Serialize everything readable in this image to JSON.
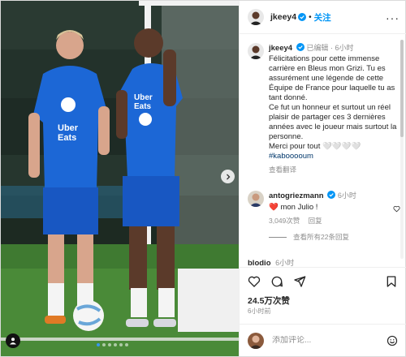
{
  "post": {
    "author": "jkeey4",
    "follow_label": "关注",
    "more_label": "···",
    "verified_icon": "verified-badge-icon",
    "accent": "#0095f6"
  },
  "caption": {
    "author": "jkeey4",
    "edited_label": "已编辑",
    "time": "6小时",
    "text": "Félicitations pour cette immense carrière en Bleus mon Grizi. Tu es assurément une légende de cette Équipe de France pour laquelle tu as tant donné.\nCe fut un honneur et surtout un réel plaisir de partager ces 3 dernières années avec le joueur mais surtout la personne.\nMerci pour tout 🤍🤍🤍🤍",
    "hashtag": "#kabooooum",
    "translate_label": "查看翻译"
  },
  "comment": {
    "author": "antogriezmann",
    "time": "6小时",
    "heart_emoji": "❤️",
    "text": "mon Julio !",
    "likes": "3,049次赞",
    "reply_label": "回复",
    "view_replies": "查看所有22条回复"
  },
  "next_comment": {
    "author": "blodio",
    "time": "6小时"
  },
  "actions": {
    "icons": [
      "heart-icon",
      "comment-icon",
      "share-icon",
      "bookmark-icon"
    ]
  },
  "stats": {
    "likes": "24.5万次赞",
    "time_ago": "6小时前"
  },
  "composer": {
    "placeholder": "添加评论..."
  },
  "carousel": {
    "current": 1,
    "count": 6
  }
}
